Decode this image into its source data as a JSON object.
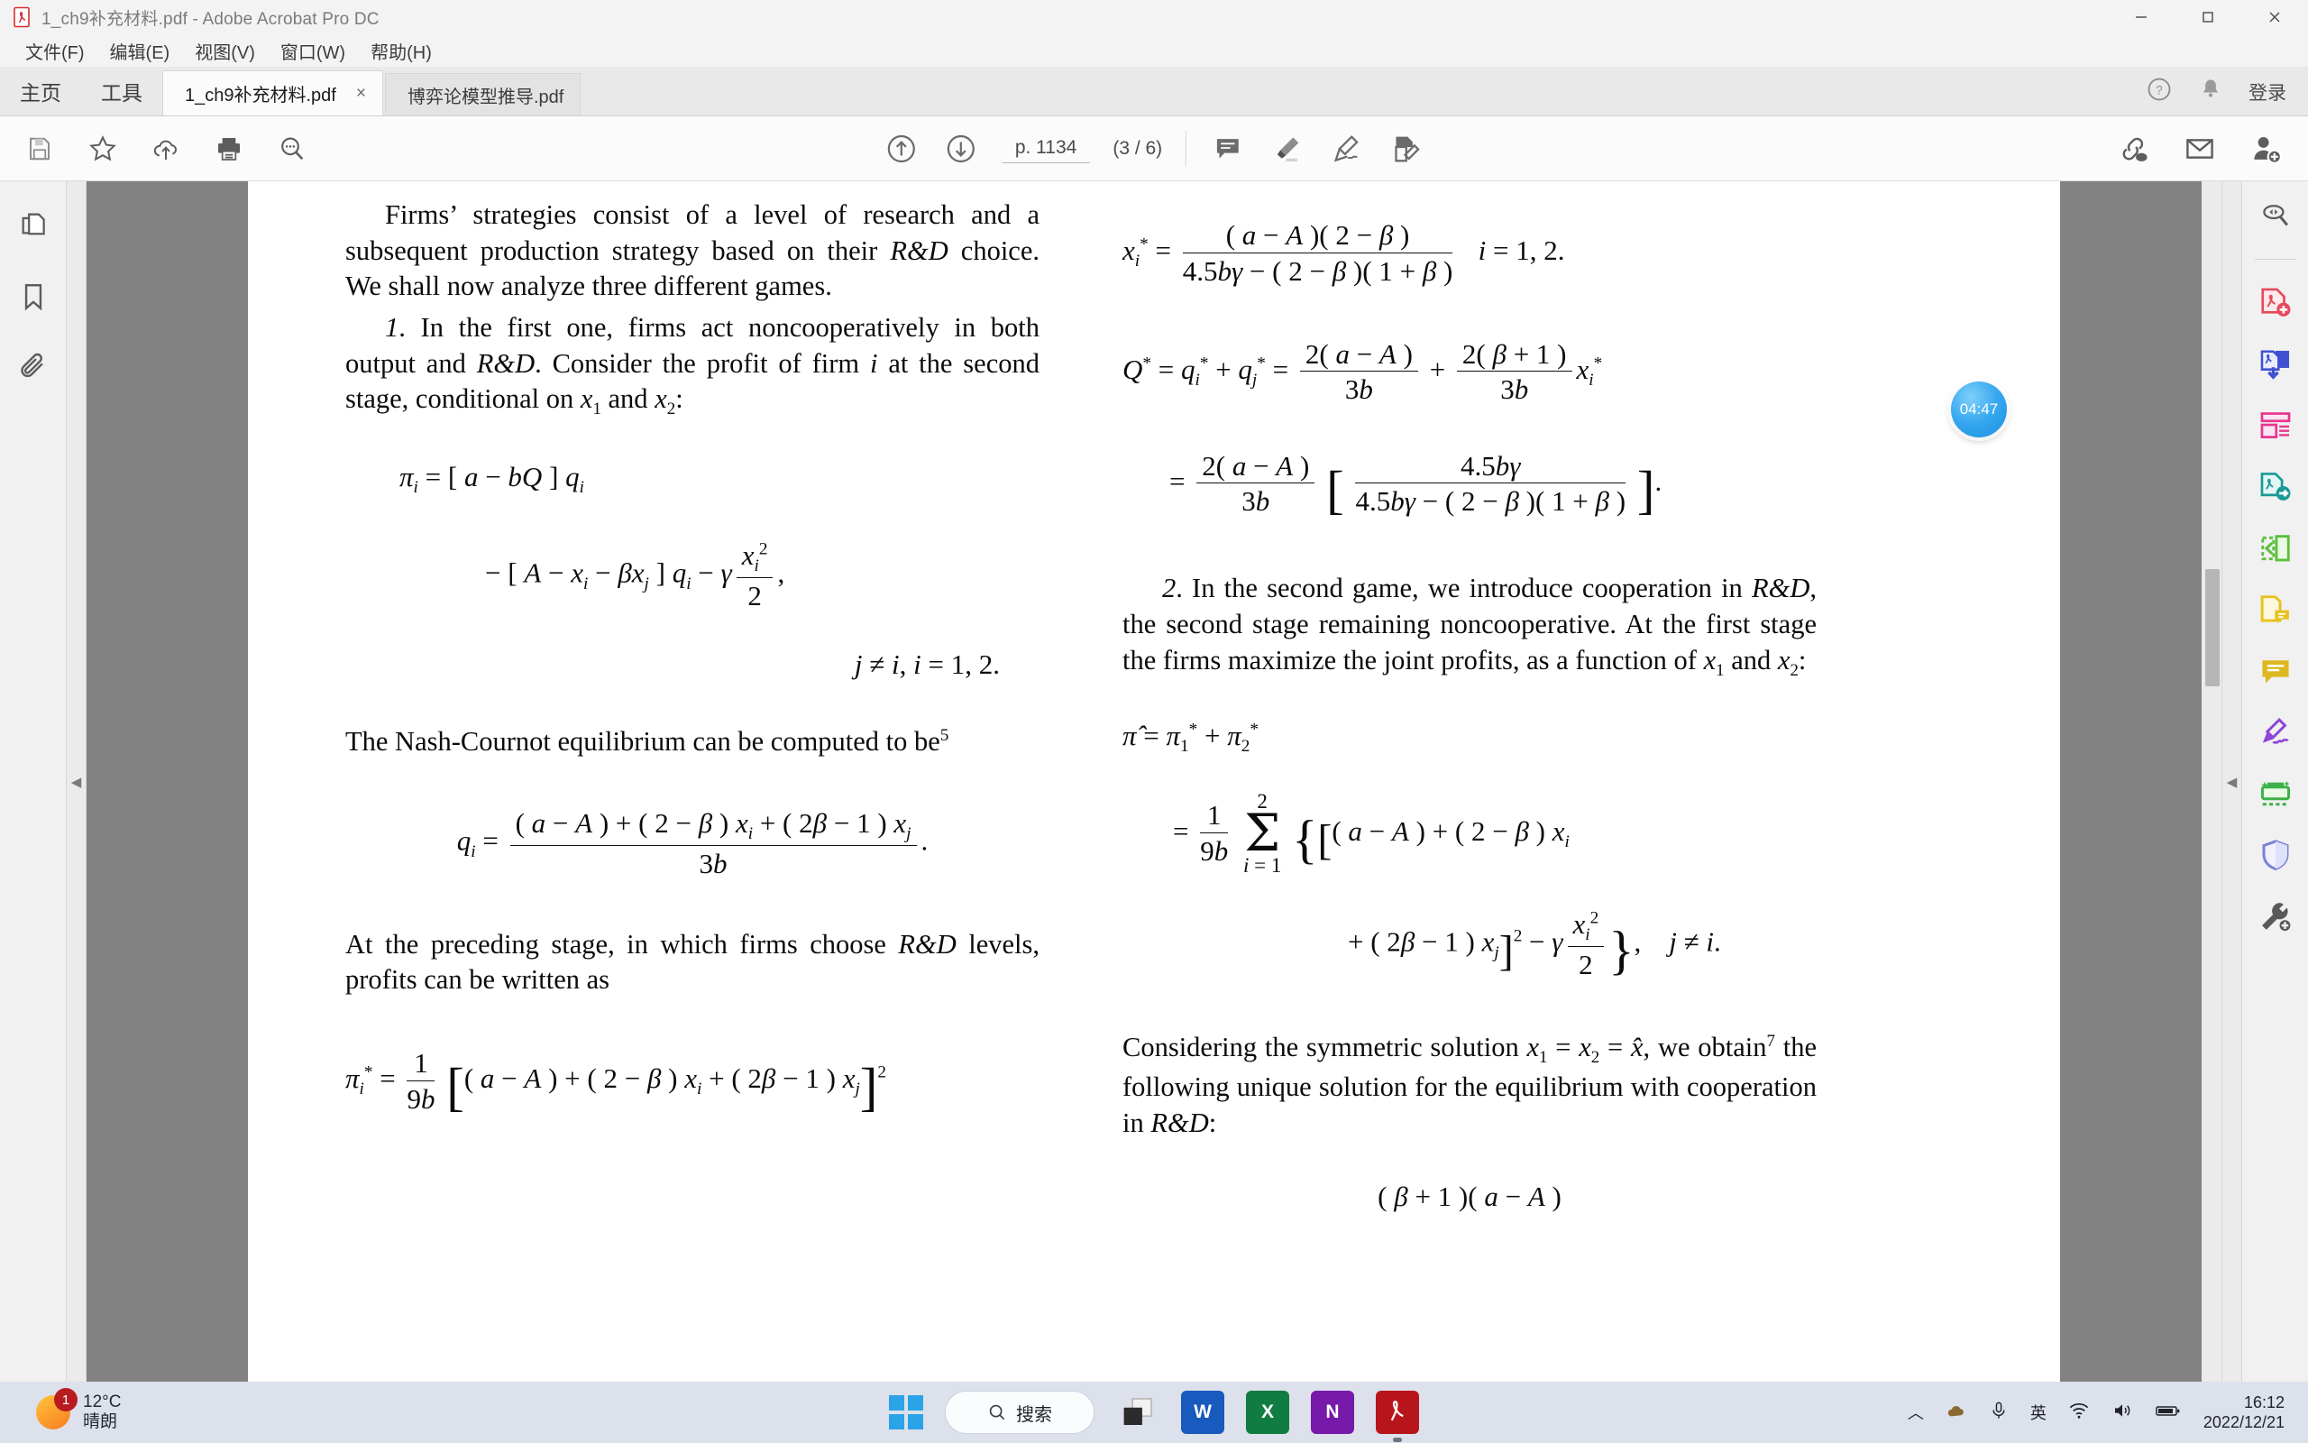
{
  "window": {
    "title": "1_ch9补充材料.pdf - Adobe Acrobat Pro DC",
    "app_icon": "acrobat-icon",
    "minimize": "—",
    "maximize": "▢",
    "close": "✕"
  },
  "menubar": {
    "items": [
      {
        "label": "文件(F)",
        "name": "menu-file"
      },
      {
        "label": "编辑(E)",
        "name": "menu-edit"
      },
      {
        "label": "视图(V)",
        "name": "menu-view"
      },
      {
        "label": "窗口(W)",
        "name": "menu-window"
      },
      {
        "label": "帮助(H)",
        "name": "menu-help"
      }
    ]
  },
  "tabstrip": {
    "home": "主页",
    "tools": "工具",
    "tabs": [
      {
        "label": "1_ch9补充材料.pdf",
        "close": "×",
        "active": true
      },
      {
        "label": "博弈论模型推导.pdf",
        "close": "",
        "active": false
      }
    ],
    "help_icon": "question-circle-icon",
    "bell_icon": "bell-icon",
    "signin": "登录"
  },
  "toolbar": {
    "left_icons": [
      "save-icon",
      "star-icon",
      "cloud-upload-icon",
      "print-icon",
      "search-zoom-icon"
    ],
    "prev_page_icon": "arrow-up-circle-icon",
    "next_page_icon": "arrow-down-circle-icon",
    "page_label": "p. 1134",
    "page_count": "(3 / 6)",
    "tool_icons": [
      "comment-icon",
      "highlight-icon",
      "sign-icon",
      "fill-and-sign-icon"
    ],
    "right_icons": [
      "share-link-icon",
      "email-icon",
      "add-person-icon"
    ]
  },
  "left_rail": {
    "items": [
      {
        "name": "page-thumbnails-icon"
      },
      {
        "name": "bookmarks-icon"
      },
      {
        "name": "attachments-icon"
      }
    ],
    "collapse": "◀"
  },
  "right_rail": {
    "expand": "◀",
    "items": [
      {
        "name": "search-document-icon",
        "color": "#5c5c5c"
      },
      {
        "name": "create-pdf-icon",
        "color": "#e8495a"
      },
      {
        "name": "combine-files-icon",
        "color": "#3f51d0"
      },
      {
        "name": "organize-pages-icon",
        "color": "#e8358f"
      },
      {
        "name": "export-pdf-icon",
        "color": "#1a9a96"
      },
      {
        "name": "edit-pdf-icon",
        "color": "#5bbf3b"
      },
      {
        "name": "comment-pdf-icon",
        "color": "#e8c11c"
      },
      {
        "name": "stamp-comment-icon",
        "color": "#d8b520"
      },
      {
        "name": "fill-sign-icon",
        "color": "#8e46d8"
      },
      {
        "name": "scan-ocr-icon",
        "color": "#3db04a"
      },
      {
        "name": "protect-icon",
        "color": "#7b80d8"
      },
      {
        "name": "more-tools-icon",
        "color": "#595959"
      }
    ]
  },
  "timer_widget": {
    "label": "04:47",
    "color": "#2aa3e8"
  },
  "document": {
    "left_column": {
      "p1": "Firms' strategies consist of a level of research and a subsequent production strategy based on their R&D choice. We shall now analyze three different games.",
      "p2": "1. In the first one, firms act noncooperatively in both output and R&D. Consider the profit of firm i at the second stage, conditional on x1 and x2:",
      "eq1_line1": "πi = [ a − bQ ] qi",
      "eq1_line2": "− [ A − xi − βxj ] qi − γ xi²/2 ,",
      "eq1_line3": "j ≠ i, i = 1, 2.",
      "p3": "The Nash-Cournot equilibrium can be computed to be",
      "p3_footnote": "5",
      "eq2": "qi = [ (a − A) + (2 − β)xi + (2β − 1)xj ] / 3b .",
      "p4": "At the preceding stage, in which firms choose R&D levels, profits can be written as",
      "eq3": "πi* = (1/9b) [ (a − A) + (2 − β)xi + (2β − 1)xj ]²"
    },
    "right_column": {
      "eq4": "xi* = (a − A)(2 − β) / [ 4.5bγ − (2 − β)(1 + β) ]",
      "eq4_tail": "i = 1, 2.",
      "eq5_line1": "Q* = qi* + qj* = 2(a − A)/3b + 2(β + 1)/3b · xi*",
      "eq5_line2": "= 2(a − A)/3b [ 4.5bγ / (4.5bγ − (2 − β)(1 + β)) ] .",
      "p5": "2. In the second game, we introduce cooperation in R&D, the second stage remaining noncooperative. At the first stage the firms maximize the joint profits, as a function of x1 and x2:",
      "eq6_line1": "π̂ = π1* + π2*",
      "eq6_line2": "= (1/9b) Σ(i=1..2) { [ (a − A) + (2 − β)xi",
      "eq6_line3": "+ (2β − 1)xj ]² − γ xi²/2 } ,  j ≠ i.",
      "p6": "Considering the symmetric solution x1 = x2 = x̂, we obtain the following unique solution for the equilibrium with cooperation in R&D:",
      "p6_footnote": "7",
      "eq7_partial": "(β + 1)(a − A)"
    }
  },
  "taskbar": {
    "weather": {
      "temp": "12°C",
      "condition": "晴朗",
      "badge": "1"
    },
    "start": "windows-start-icon",
    "search_placeholder": "搜索",
    "apps": [
      {
        "name": "task-view-icon",
        "letter": "",
        "color": "#2b2b2b"
      },
      {
        "name": "word-icon",
        "letter": "W",
        "color": "#185abd"
      },
      {
        "name": "excel-icon",
        "letter": "X",
        "color": "#107c41"
      },
      {
        "name": "onenote-icon",
        "letter": "N",
        "color": "#7719aa"
      },
      {
        "name": "acrobat-taskbar-icon",
        "letter": "",
        "color": "#b8151b"
      }
    ],
    "tray": {
      "chevron": "︿",
      "icons": [
        "onedrive-icon",
        "microphone-icon"
      ],
      "ime": "英",
      "wifi": "wifi-icon",
      "volume": "volume-icon",
      "battery": "battery-icon"
    },
    "clock": {
      "time": "16:12",
      "date": "2022/12/21"
    }
  }
}
